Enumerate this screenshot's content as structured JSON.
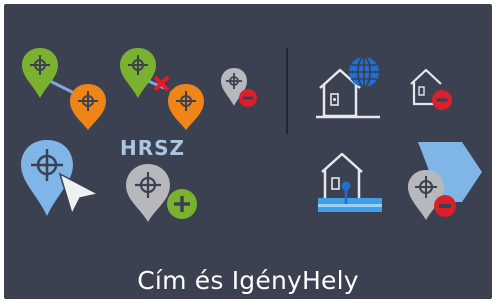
{
  "ribbon_panel": {
    "title": "Cím és IgényHely",
    "hrsz_label": "HRSZ",
    "colors": {
      "background": "#3b4150",
      "green": "#7ab22f",
      "orange": "#ef8417",
      "gray_pin": "#b6b8bc",
      "blue_pin": "#7fb5e7",
      "red": "#dd1e2b",
      "house_stroke": "#e6e8ea",
      "globe": "#1f6fd6",
      "title_text": "#ffffff"
    }
  }
}
